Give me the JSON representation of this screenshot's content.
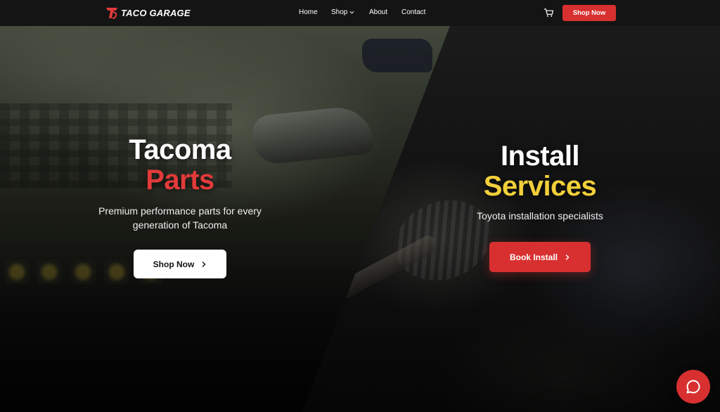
{
  "header": {
    "logo_text": "TACO GARAGE",
    "nav": [
      {
        "label": "Home"
      },
      {
        "label": "Shop"
      },
      {
        "label": "About"
      },
      {
        "label": "Contact"
      }
    ],
    "cta_label": "Shop Now"
  },
  "hero": {
    "left": {
      "title_line1": "Tacoma",
      "title_line2": "Parts",
      "subtitle": "Premium performance parts for every generation of Tacoma",
      "button_label": "Shop Now"
    },
    "right": {
      "title_line1": "Install",
      "title_line2": "Services",
      "subtitle": "Toyota installation specialists",
      "button_label": "Book Install"
    }
  },
  "icons": {
    "logo": "taco-garage-logo-icon",
    "cart": "cart-icon",
    "chat": "chat-bubble-icon",
    "nav_chevron": "chevron-down-icon",
    "button_arrow": "chevron-right-icon"
  },
  "colors": {
    "accent_red": "#d83030",
    "title_red": "#e23a3a",
    "title_yellow": "#f2cf3a",
    "header_bg": "#141414"
  }
}
